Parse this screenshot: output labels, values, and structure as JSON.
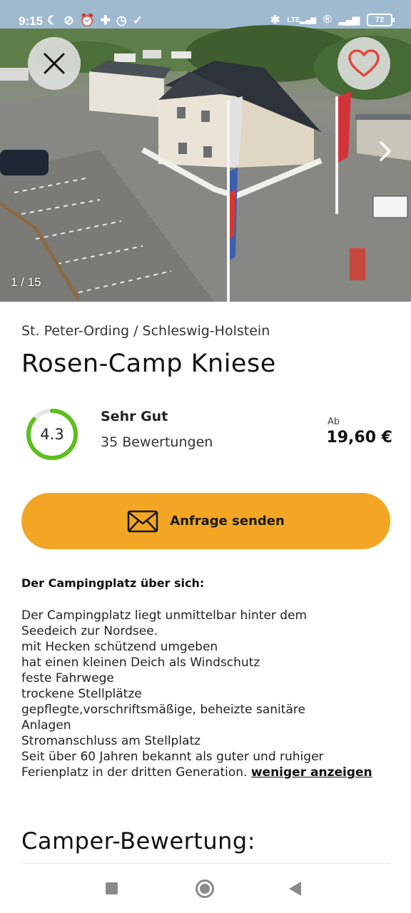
{
  "statusbar": {
    "time": "9:15",
    "left_icons": [
      "moon-icon",
      "mute-icon",
      "alarm-icon",
      "slack-icon",
      "clock-icon",
      "check-icon"
    ],
    "right_icons": [
      "bluetooth-icon",
      "signal-icon",
      "registered-icon",
      "wifi-icon"
    ],
    "battery": "72",
    "network": "LTE"
  },
  "gallery": {
    "counter": "1 / 15"
  },
  "listing": {
    "location": "St. Peter-Ording / Schleswig-Holstein",
    "title": "Rosen-Camp Kniese",
    "rating": {
      "value": "4.3",
      "score_fraction": 0.86,
      "label": "Sehr Gut",
      "count": "35 Bewertungen"
    },
    "price_prefix": "Ab",
    "price": "19,60 €",
    "cta_label": "Anfrage senden"
  },
  "about": {
    "heading": "Der Campingplatz über sich:",
    "lines": [
      "Der Campingplatz liegt unmittelbar hinter dem",
      "Seedeich zur Nordsee.",
      "mit Hecken schützend umgeben",
      "hat einen kleinen Deich als Windschutz",
      "feste Fahrwege",
      "trockene Stellplätze",
      "gepflegte,vorschriftsmäßige, beheizte sanitäre",
      "Anlagen",
      "Stromanschluss am Stellplatz",
      "Seit über 60 Jahren bekannt als guter und ruhiger",
      "Ferienplatz in der dritten Generation."
    ],
    "less_link": "weniger anzeigen"
  },
  "reviews": {
    "heading": "Camper-Bewertung:"
  },
  "colors": {
    "accent": "#f2a623",
    "rating_green": "#5bbf1c",
    "heart_red": "#e8453c"
  }
}
